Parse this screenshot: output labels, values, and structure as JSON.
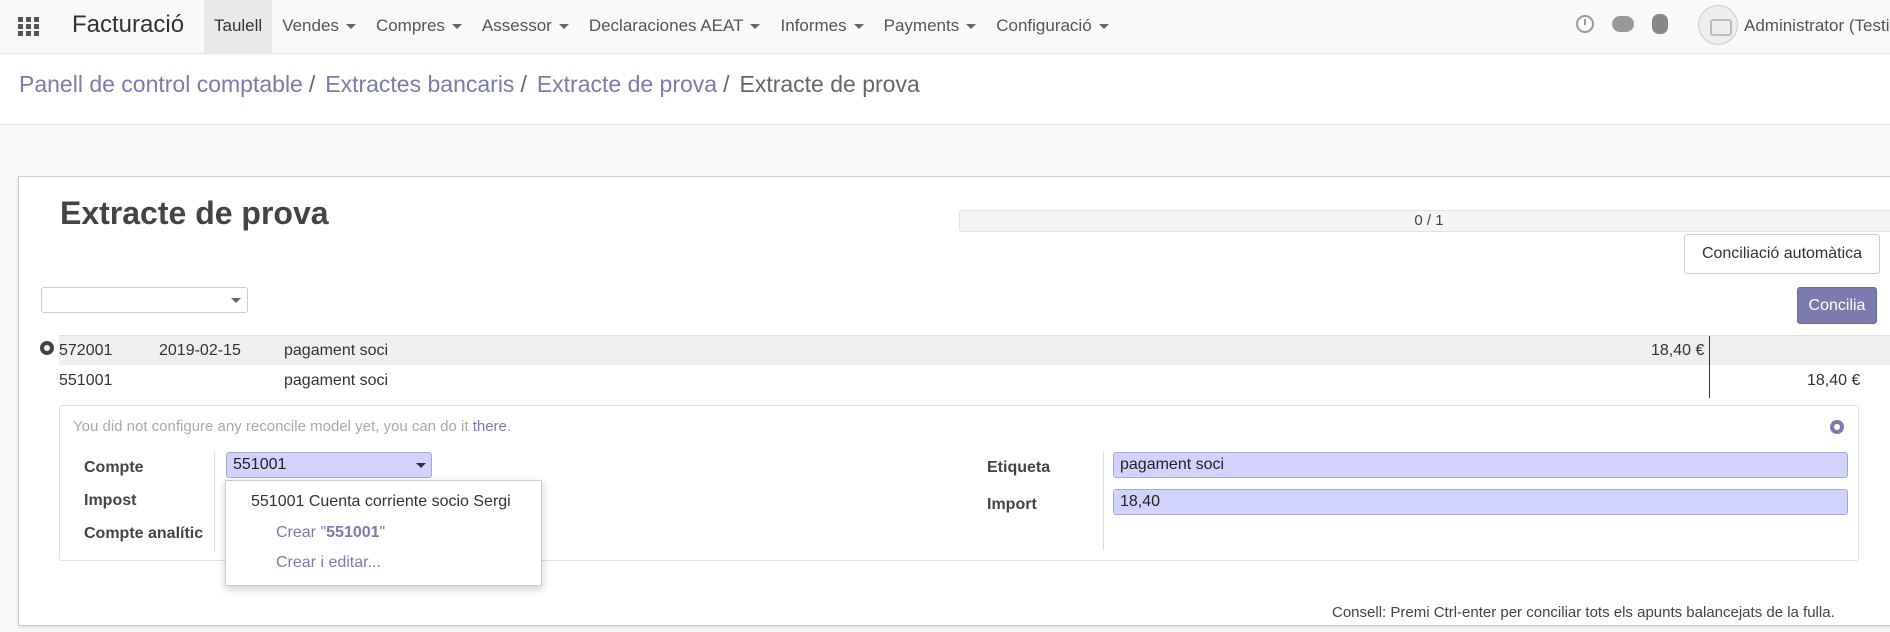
{
  "app": {
    "name": "Facturació",
    "menu": [
      {
        "label": "Taulell",
        "active": true,
        "dropdown": false
      },
      {
        "label": "Vendes",
        "active": false,
        "dropdown": true
      },
      {
        "label": "Compres",
        "active": false,
        "dropdown": true
      },
      {
        "label": "Assessor",
        "active": false,
        "dropdown": true
      },
      {
        "label": "Declaraciones AEAT",
        "active": false,
        "dropdown": true
      },
      {
        "label": "Informes",
        "active": false,
        "dropdown": true
      },
      {
        "label": "Payments",
        "active": false,
        "dropdown": true
      },
      {
        "label": "Configuració",
        "active": false,
        "dropdown": true
      }
    ],
    "user": "Administrator (Testin"
  },
  "breadcrumb": {
    "items": [
      "Panell de control comptable",
      "Extractes bancaris",
      "Extracte de prova"
    ],
    "separator": "/",
    "current": "Extracte de prova"
  },
  "statement": {
    "title": "Extracte de prova",
    "progress": "0 / 1",
    "progress_fraction": 0,
    "auto_reconcile_label": "Conciliació automàtica",
    "reconcile_label": "Concilia",
    "filter_value": ""
  },
  "lines": {
    "main": {
      "account": "572001",
      "date": "2019-02-15",
      "label": "pagament soci",
      "amount": "18,40 €"
    },
    "counterpart": {
      "account": "551001",
      "label": "pagament soci",
      "amount": "18,40 €"
    }
  },
  "reconcile": {
    "hint_text": "You did not configure any reconcile model yet, you can do it ",
    "hint_link": "there",
    "hint_end": ".",
    "account_label": "Compte",
    "account_value": "551001",
    "tax_label": "Impost",
    "analytic_label": "Compte analític",
    "tag_label": "Etiqueta",
    "tag_value": "pagament soci",
    "amount_label": "Import",
    "amount_value": "18,40"
  },
  "dropdown": {
    "option": "551001 Cuenta corriente socio Sergi",
    "create_prefix": "Crear \"",
    "create_value": "551001",
    "create_suffix": "\"",
    "create_edit": "Crear i editar..."
  },
  "tip": "Consell: Premi Ctrl-enter per conciliar tots els apunts balancejats de la fulla.",
  "colors": {
    "accent": "#7c7bad",
    "field_bg": "#d2d2ff"
  }
}
